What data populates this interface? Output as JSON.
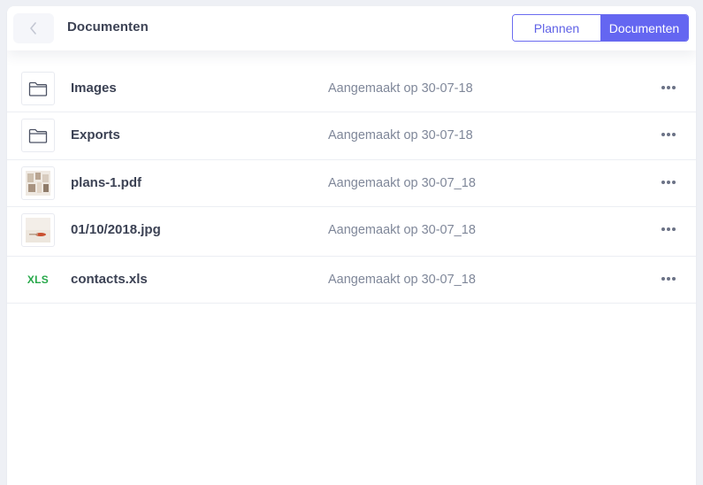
{
  "header": {
    "title": "Documenten",
    "back_icon": "chevron-left-icon",
    "toggle": {
      "options": [
        "Plannen",
        "Documenten"
      ],
      "selected": "Documenten"
    }
  },
  "colors": {
    "accent": "#6466f1",
    "xls_green": "#27a84a"
  },
  "files": [
    {
      "name": "Images",
      "created": "Aangemaakt op 30-07-18",
      "icon": "folder-icon"
    },
    {
      "name": "Exports",
      "created": "Aangemaakt op 30-07-18",
      "icon": "folder-icon"
    },
    {
      "name": "plans-1.pdf",
      "created": "Aangemaakt op 30-07_18",
      "icon": "pdf-thumbnail"
    },
    {
      "name": "01/10/2018.jpg",
      "created": "Aangemaakt op 30-07_18",
      "icon": "jpg-thumbnail"
    },
    {
      "name": "contacts.xls",
      "created": "Aangemaakt op 30-07_18",
      "icon": "xls-icon",
      "icon_label": "XLS"
    }
  ],
  "row_menu_icon": "more-horizontal-icon"
}
